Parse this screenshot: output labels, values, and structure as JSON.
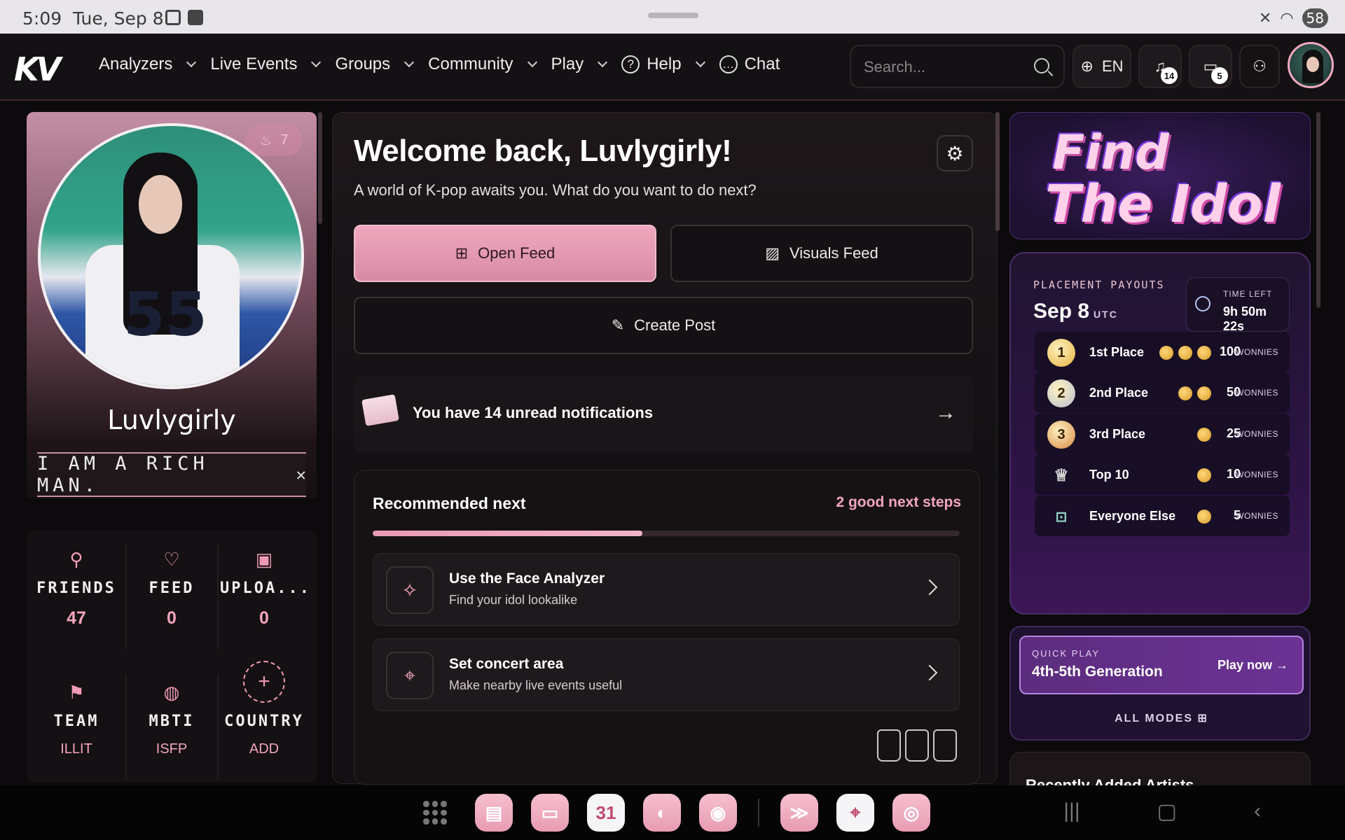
{
  "status_bar": {
    "time": "5:09",
    "date": "Tue, Sep 8",
    "battery": "58"
  },
  "nav": {
    "logo": "KV",
    "items": [
      {
        "label": "Analyzers",
        "dropdown": true
      },
      {
        "label": "Live Events",
        "dropdown": true
      },
      {
        "label": "Groups",
        "dropdown": true
      },
      {
        "label": "Community",
        "dropdown": true
      },
      {
        "label": "Play",
        "dropdown": true
      },
      {
        "label": "Help",
        "dropdown": true,
        "icon": "help-circle-icon"
      },
      {
        "label": "Chat",
        "dropdown": false,
        "icon": "chat-bubble-icon"
      }
    ],
    "search_placeholder": "Search...",
    "language": "EN",
    "notifications_count": "14",
    "messages_count": "5"
  },
  "profile": {
    "streak": "7",
    "username": "Luvlygirly",
    "motto": "I AM A RICH MAN.",
    "jersey_number": "55",
    "stats": [
      {
        "label": "FRIENDS",
        "value": "47",
        "icon": "user-icon"
      },
      {
        "label": "FEED",
        "value": "0",
        "icon": "heart-icon"
      },
      {
        "label": "UPLOA...",
        "value": "0",
        "icon": "image-icon"
      },
      {
        "label": "TEAM",
        "value": "ILLIT",
        "icon": "flag-icon"
      },
      {
        "label": "MBTI",
        "value": "ISFP",
        "icon": "brain-icon"
      },
      {
        "label": "COUNTRY",
        "value": "ADD",
        "icon": "add-circle-icon"
      }
    ]
  },
  "center": {
    "welcome": "Welcome back, Luvlygirly!",
    "subtitle": "A world of K-pop awaits you. What do you want to do next?",
    "open_feed": "Open Feed",
    "visuals_feed": "Visuals Feed",
    "create_post": "Create Post",
    "notification_text": "You have 14 unread notifications",
    "recommended_title": "Recommended next",
    "recommended_count": "2 good next steps",
    "recommended_progress": 0.46,
    "steps": [
      {
        "title": "Use the Face Analyzer",
        "desc": "Find your idol lookalike",
        "icon": "sparkles-icon"
      },
      {
        "title": "Set concert area",
        "desc": "Make nearby live events useful",
        "icon": "location-pin-icon"
      }
    ]
  },
  "find_the_idol": {
    "line1": "Find",
    "line2": "The Idol"
  },
  "payouts": {
    "kicker": "PLACEMENT PAYOUTS",
    "date": "Sep 8",
    "tz": "UTC",
    "time_left_label": "TIME LEFT",
    "time_left_value": "9h 50m 22s",
    "unit": "WONNIES",
    "rows": [
      {
        "label": "1st Place",
        "amount": "100",
        "coins": 3,
        "medal": "1",
        "color": "#e4b03f"
      },
      {
        "label": "2nd Place",
        "amount": "50",
        "coins": 2,
        "medal": "2",
        "color": "#b9bfd0"
      },
      {
        "label": "3rd Place",
        "amount": "25",
        "coins": 1,
        "medal": "3",
        "color": "#d98a45"
      },
      {
        "label": "Top 10",
        "amount": "10",
        "coins": 1,
        "medal": "",
        "color": ""
      },
      {
        "label": "Everyone Else",
        "amount": "5",
        "coins": 1,
        "medal": "",
        "color": ""
      }
    ]
  },
  "quick_play": {
    "kicker": "QUICK PLAY",
    "title": "4th-5th Generation",
    "cta": "Play now",
    "all_modes": "ALL MODES"
  },
  "recent": {
    "title": "Recently Added Artists"
  },
  "dock": {
    "calendar_day": "31"
  }
}
